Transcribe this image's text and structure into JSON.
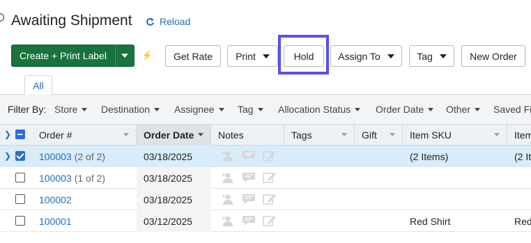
{
  "header": {
    "title": "Awaiting Shipment",
    "reload_label": "Reload"
  },
  "toolbar": {
    "create_print_label": "Create + Print Label",
    "get_rate": "Get Rate",
    "print": "Print",
    "hold": "Hold",
    "assign_to": "Assign To",
    "tag": "Tag",
    "new_order": "New Order"
  },
  "tabs": [
    {
      "label": "All"
    }
  ],
  "filters": {
    "label": "Filter By:",
    "items": [
      "Store",
      "Destination",
      "Assignee",
      "Tag",
      "Allocation Status",
      "Order Date",
      "Other",
      "Saved Fi"
    ]
  },
  "table": {
    "columns": [
      "Order #",
      "Order Date",
      "Notes",
      "Tags",
      "Gift",
      "Item SKU",
      "Item"
    ],
    "sorted_column": "Order Date",
    "rows": [
      {
        "order": "100003",
        "sub": "(2 of 2)",
        "date": "03/18/2025",
        "sku": "(2 Items)",
        "item": "(2 It",
        "selected": true,
        "expandable": true
      },
      {
        "order": "100003",
        "sub": "(1 of 2)",
        "date": "03/18/2025",
        "sku": "",
        "item": "",
        "selected": false,
        "expandable": false
      },
      {
        "order": "100002",
        "sub": "",
        "date": "03/18/2025",
        "sku": "",
        "item": "",
        "selected": false,
        "expandable": false
      },
      {
        "order": "100001",
        "sub": "",
        "date": "03/12/2025",
        "sku": "Red Shirt",
        "item": "Red",
        "selected": false,
        "expandable": false
      }
    ]
  },
  "colors": {
    "primary_green": "#18733c",
    "link_blue": "#1f6fb8",
    "highlight": "#5a4fee",
    "selected_row": "#d8ecf9"
  }
}
